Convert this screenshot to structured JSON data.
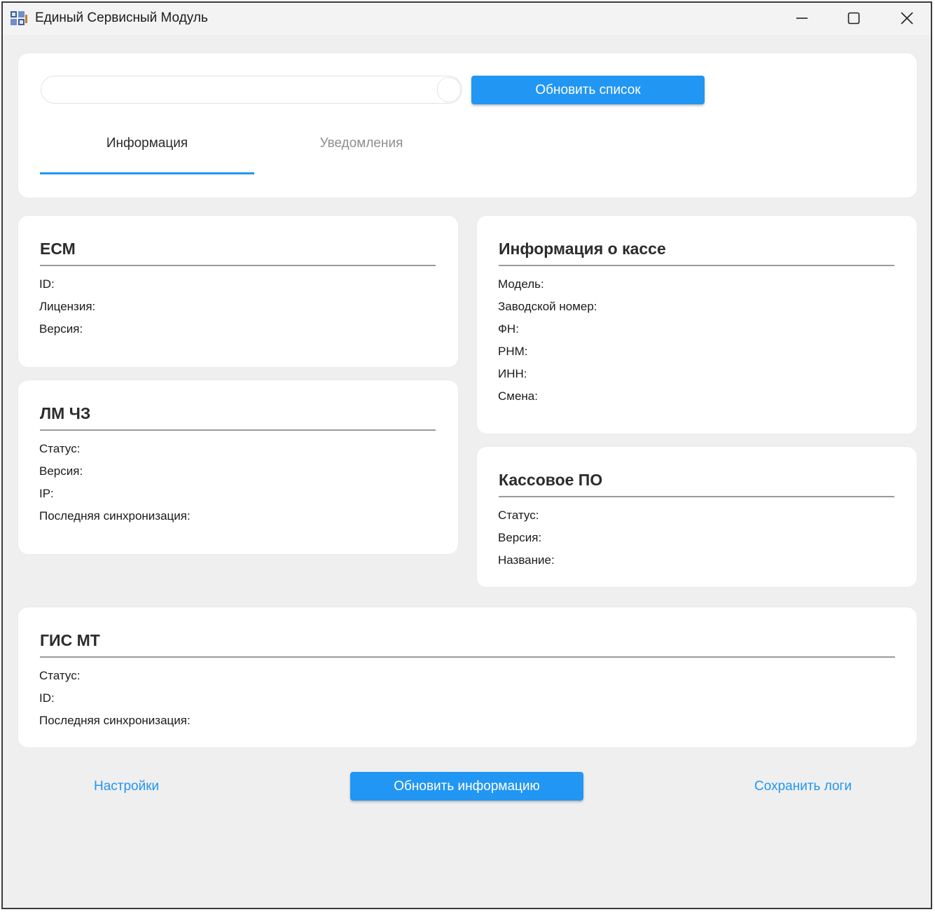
{
  "window": {
    "title": "Единый Сервисный Модуль"
  },
  "top_panel": {
    "search_value": "",
    "refresh_list_label": "Обновить список",
    "tabs": [
      {
        "label": "Информация",
        "active": true
      },
      {
        "label": "Уведомления",
        "active": false
      }
    ]
  },
  "ecm": {
    "title": "ЕСМ",
    "fields": [
      "ID:",
      "Лицензия:",
      "Версия:"
    ]
  },
  "lm": {
    "title": "ЛМ ЧЗ",
    "fields": [
      "Статус:",
      "Версия:",
      "IP:",
      "Последняя синхронизация:"
    ]
  },
  "kassa": {
    "title": "Информация о кассе",
    "fields": [
      "Модель:",
      "Заводской номер:",
      "ФН:",
      "РНМ:",
      "ИНН:",
      "Смена:"
    ]
  },
  "po": {
    "title": "Кассовое ПО",
    "fields": [
      "Статус:",
      "Версия:",
      "Название:"
    ]
  },
  "gis": {
    "title": "ГИС МТ",
    "fields": [
      "Статус:",
      "ID:",
      "Последняя синхронизация:"
    ]
  },
  "footer": {
    "settings_label": "Настройки",
    "refresh_info_label": "Обновить информацию",
    "save_logs_label": "Сохранить логи"
  },
  "colors": {
    "accent": "#2196f3",
    "background": "#efefef",
    "card": "#ffffff"
  },
  "icons": [
    "app-icon",
    "minimize-icon",
    "maximize-icon",
    "close-icon"
  ]
}
